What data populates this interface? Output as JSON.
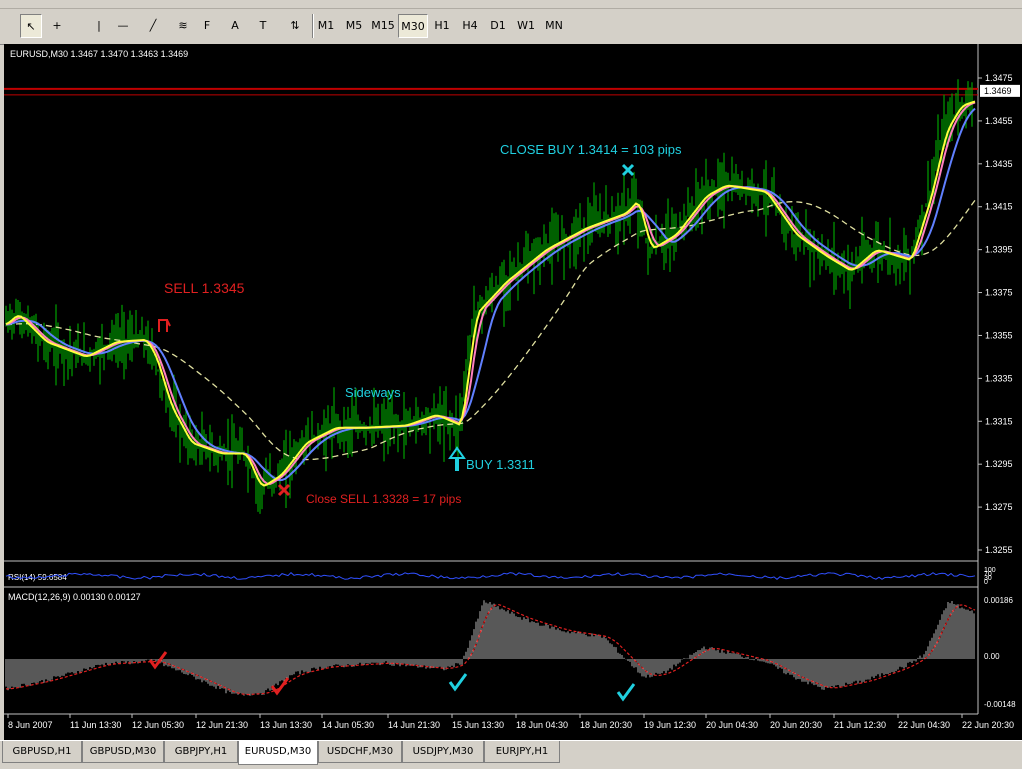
{
  "toolbar": {
    "tools": [
      {
        "name": "cursor-icon",
        "glyph": "↖"
      },
      {
        "name": "crosshair-icon",
        "glyph": "+"
      },
      {
        "name": "vertical-line-icon",
        "glyph": "|"
      },
      {
        "name": "horizontal-line-icon",
        "glyph": "—"
      },
      {
        "name": "trendline-icon",
        "glyph": "╱"
      },
      {
        "name": "channel-icon",
        "glyph": "≋"
      },
      {
        "name": "fibonacci-icon",
        "glyph": "F"
      },
      {
        "name": "text-icon",
        "glyph": "A"
      },
      {
        "name": "text-label-icon",
        "glyph": "T"
      },
      {
        "name": "arrows-icon",
        "glyph": "⇅"
      }
    ],
    "timeframes": [
      "M1",
      "M5",
      "M15",
      "M30",
      "H1",
      "H4",
      "D1",
      "W1",
      "MN"
    ],
    "active_timeframe": "M30"
  },
  "chart": {
    "info": "EURUSD,M30  1.3467 1.3470 1.3463 1.3469",
    "current_price": "1.3469",
    "price_ticks": [
      "1.3475",
      "1.3455",
      "1.3435",
      "1.3415",
      "1.3395",
      "1.3375",
      "1.3355",
      "1.3335",
      "1.3315",
      "1.3295",
      "1.3275",
      "1.3255"
    ],
    "annotations": {
      "sell": "SELL 1.3345",
      "close_sell": "Close SELL 1.3328 = 17 pips",
      "sideways": "Sideways",
      "buy": "BUY 1.3311",
      "close_buy": "CLOSE BUY 1.3414 = 103 pips"
    },
    "rsi_label": "RSI(14) 59.6584",
    "rsi_ticks": [
      "100",
      "70",
      "30",
      "0"
    ],
    "macd_label": "MACD(12,26,9) 0.00130 0.00127",
    "macd_ticks": [
      "0.00186",
      "0.00",
      "-0.00148"
    ],
    "time_ticks": [
      "8 Jun 2007",
      "11 Jun 13:30",
      "12 Jun 05:30",
      "12 Jun 21:30",
      "13 Jun 13:30",
      "14 Jun 05:30",
      "14 Jun 21:30",
      "15 Jun 13:30",
      "18 Jun 04:30",
      "18 Jun 20:30",
      "19 Jun 12:30",
      "20 Jun 04:30",
      "20 Jun 20:30",
      "21 Jun 12:30",
      "22 Jun 04:30",
      "22 Jun 20:30"
    ],
    "colors": {
      "price": "#00a000",
      "ema_fast": "#ffff40",
      "ema_mid": "#ff80c0",
      "ema_slow": "#6080ff",
      "sma_long": "#e0e0a0",
      "sell": "#e02020",
      "buy": "#20d0e0",
      "macd_hist": "#b0b0b0",
      "macd_signal": "#e02020",
      "rsi": "#3050ff"
    }
  },
  "chart_data": {
    "type": "line",
    "title": "EURUSD,M30",
    "x": [
      "8 Jun 2007",
      "11 Jun 13:30",
      "12 Jun 05:30",
      "12 Jun 21:30",
      "13 Jun 13:30",
      "14 Jun 05:30",
      "14 Jun 21:30",
      "15 Jun 13:30",
      "18 Jun 04:30",
      "18 Jun 20:30",
      "19 Jun 12:30",
      "20 Jun 04:30",
      "20 Jun 20:30",
      "21 Jun 12:30",
      "22 Jun 04:30",
      "22 Jun 20:30"
    ],
    "series": [
      {
        "name": "EURUSD",
        "values": [
          1.3365,
          1.335,
          1.3358,
          1.3315,
          1.329,
          1.3312,
          1.3315,
          1.3318,
          1.34,
          1.3418,
          1.3405,
          1.3428,
          1.34,
          1.339,
          1.3395,
          1.3462
        ]
      }
    ],
    "ylim": [
      1.325,
      1.348
    ]
  },
  "tabs": [
    "GBPUSD,H1",
    "GBPUSD,M30",
    "GBPJPY,H1",
    "EURUSD,M30",
    "USDCHF,M30",
    "USDJPY,M30",
    "EURJPY,H1"
  ],
  "active_tab": "EURUSD,M30"
}
